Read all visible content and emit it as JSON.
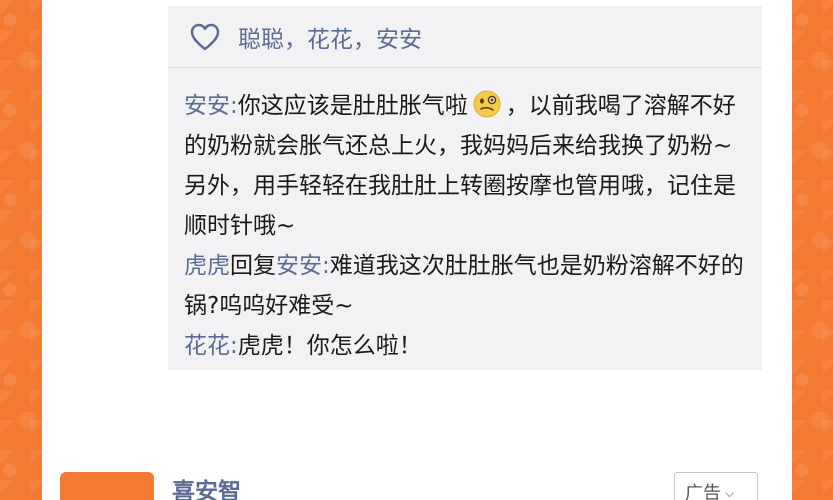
{
  "likes": {
    "names": "聪聪，花花，安安"
  },
  "replies": [
    {
      "user": "安安",
      "separator": ":",
      "text_before_emoji": "你这应该是肚肚胀气啦",
      "emoji": "thinking-face",
      "text_after_emoji": "，以前我喝了溶解不好的奶粉就会胀气还总上火，我妈妈后来给我换了奶粉~另外，用手轻轻在我肚肚上转圈按摩也管用哦，记住是顺时针哦~"
    },
    {
      "user": "虎虎",
      "reply_word": "回复",
      "target": "安安",
      "separator": ":",
      "text": "难道我这次肚肚胀气也是奶粉溶解不好的锅?呜呜好难受~"
    },
    {
      "user": "花花",
      "separator": ":",
      "text": "虎虎！你怎么啦！"
    }
  ],
  "ad": {
    "name": "喜安智",
    "badge": "广告"
  }
}
